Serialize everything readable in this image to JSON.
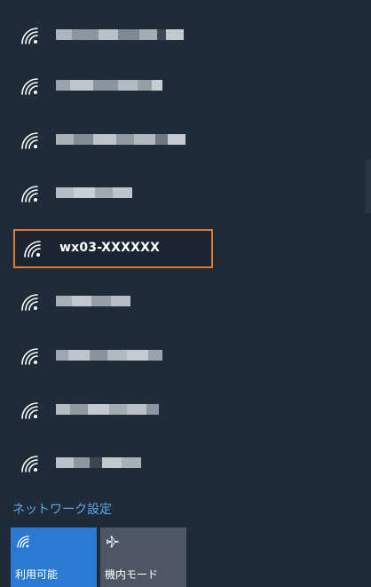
{
  "networks": [
    {
      "id": "net-1",
      "name": "",
      "redacted": true
    },
    {
      "id": "net-2",
      "name": "",
      "redacted": true
    },
    {
      "id": "net-3",
      "name": "",
      "redacted": true
    },
    {
      "id": "net-4",
      "name": "",
      "redacted": true
    },
    {
      "id": "net-5",
      "name": "wx03-XXXXXX",
      "redacted": false,
      "selected": true
    },
    {
      "id": "net-6",
      "name": "",
      "redacted": true
    },
    {
      "id": "net-7",
      "name": "",
      "redacted": true
    },
    {
      "id": "net-8",
      "name": "",
      "redacted": true
    },
    {
      "id": "net-9",
      "name": "",
      "redacted": true
    }
  ],
  "settings_link": "ネットワーク設定",
  "quick_actions": {
    "wifi": {
      "label": "利用可能",
      "icon": "wifi-icon",
      "active": true
    },
    "airplane": {
      "label": "機内モード",
      "icon": "airplane-icon",
      "active": false
    }
  },
  "colors": {
    "background": "#1f2b38",
    "highlight_border": "#e07a30",
    "link": "#5aa8f0",
    "tile_active": "#2a7ad3",
    "tile_inactive": "#4c5763"
  }
}
